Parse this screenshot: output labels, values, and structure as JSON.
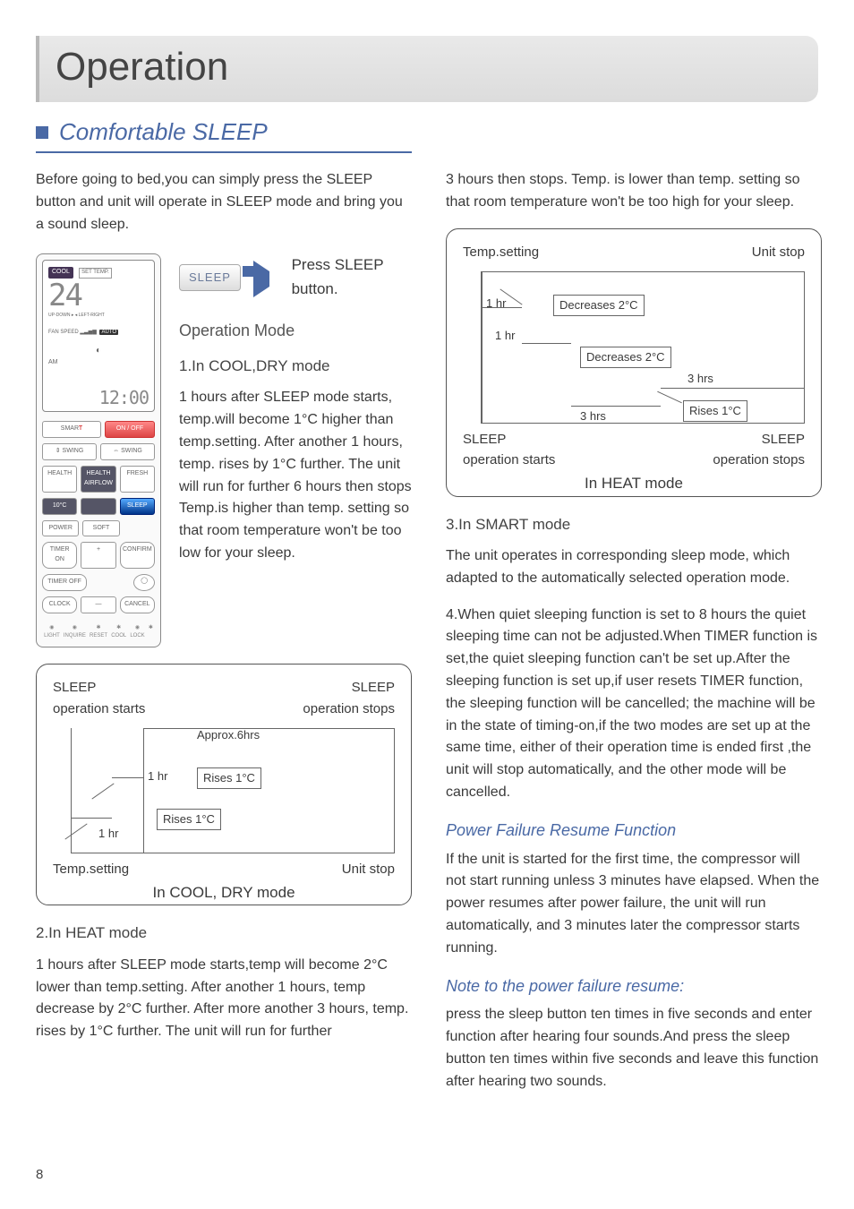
{
  "title": "Operation",
  "section": "Comfortable SLEEP",
  "intro": "Before going to bed,you can simply press the SLEEP button and unit will operate in SLEEP mode and bring you a sound sleep.",
  "sleep_chip": "SLEEP",
  "press_sleep": "Press SLEEP button.",
  "operation_mode": "Operation Mode",
  "mode1_head": "1.In COOL,DRY mode",
  "mode1_text": "1 hours after SLEEP mode starts, temp.will become 1°C higher than temp.setting. After another 1 hours, temp. rises by 1°C further. The unit will run for further 6 hours then stops Temp.is higher than temp. setting so that room temperature won't be too low for your sleep.",
  "mode2_head": "2.In HEAT mode",
  "mode2_text": "1 hours after SLEEP mode starts,temp will become 2°C lower than temp.setting. After another 1 hours, temp decrease by 2°C further. After more another 3 hours, temp. rises by 1°C further. The unit will run for further",
  "right_cont": "3 hours then stops. Temp. is lower than temp. setting so that room temperature won't be too high for your sleep.",
  "mode3_head": "3.In SMART mode",
  "mode3_text": "The unit operates in corresponding sleep mode, which adapted to the automatically selected operation mode.",
  "mode4_text": "4.When quiet sleeping function is set to 8 hours the quiet sleeping time can not be adjusted.When TIMER function is set,the quiet sleeping function can't be set up.After the sleeping function is set up,if user resets TIMER function, the sleeping function will be cancelled; the machine will be in the state of timing-on,if the two modes are set up at the same time, either of their operation time is ended first ,the unit will stop automatically, and the other mode will be cancelled.",
  "pfr_head": "Power Failure Resume Function",
  "pfr_text": "If the unit is started for the first time, the compressor will not start running unless 3 minutes have elapsed. When the power resumes after power failure, the unit will run automatically, and 3 minutes later the compressor starts running.",
  "note_head": "Note to the power failure resume:",
  "note_text": "press the sleep button ten times in five seconds and enter function after hearing four sounds.And press the sleep button ten times within five seconds and leave this function after hearing two sounds.",
  "page": "8",
  "chart_cool": {
    "title": "In COOL, DRY mode",
    "tl": "SLEEP operation starts",
    "tr": "SLEEP operation stops",
    "approx": "Approx.6hrs",
    "h1": "1 hr",
    "h2": "1 hr",
    "r1": "Rises 1°C",
    "r2": "Rises 1°C",
    "bl": "Temp.setting",
    "br": "Unit stop"
  },
  "chart_heat": {
    "title": "In HEAT mode",
    "tl": "Temp.setting",
    "tr": "Unit stop",
    "h1": "1 hr",
    "h2": "1 hr",
    "d1": "Decreases 2°C",
    "d2": "Decreases 2°C",
    "h3": "3 hrs",
    "h4": "3 hrs",
    "r1": "Rises 1°C",
    "bl": "SLEEP operation starts",
    "br": "SLEEP operation stops"
  },
  "remote": {
    "cool": "COOL",
    "settemp": "SET TEMP.",
    "temp": "24",
    "fan": "FAN SPEED",
    "auto": "AUTO",
    "am": "AM",
    "clock": "12:00",
    "smart": "SMART",
    "onoff": "ON / OFF",
    "swing1": "⇕ SWING",
    "swing2": "⇔ SWING",
    "health": "HEALTH",
    "haf": "HEALTH AIRFLOW",
    "fresh": "FRESH",
    "tenc": "10°C",
    "sleep": "SLEEP",
    "power": "POWER",
    "soft": "SOFT",
    "timeron": "TIMER ON",
    "plus": "+",
    "confirm": "CONFIRM",
    "timeroff": "TIMER OFF",
    "clockbtn": "CLOCK",
    "minus": "—",
    "cancel": "CANCEL",
    "i1": "LIGHT",
    "i2": "INQUIRE",
    "i3": "RESET",
    "i4": "COOL",
    "i5": "LOCK"
  }
}
